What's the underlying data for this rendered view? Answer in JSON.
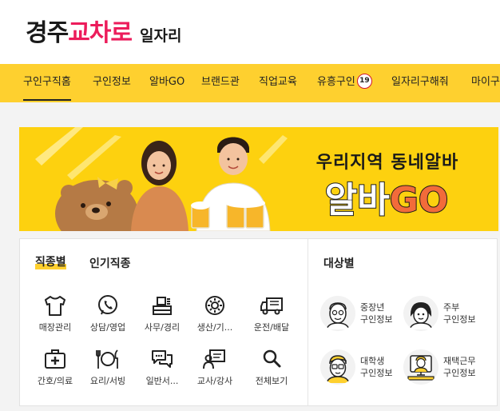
{
  "logo": {
    "part1": "경주",
    "part2": "교차로",
    "part3": "일자리"
  },
  "nav": {
    "items": [
      "구인구직홈",
      "구인정보",
      "알바GO",
      "브랜드관",
      "직업교육",
      "유흥구인",
      "일자리구해줘",
      "마이구"
    ],
    "badge": "19"
  },
  "banner": {
    "line1": "우리지역 동네알바",
    "line2a": "알바",
    "line2b": "GO"
  },
  "jobs_panel": {
    "tab_category": "직종별",
    "tab_popular": "인기직종",
    "items": [
      {
        "label": "매장관리",
        "icon": "shirt-icon"
      },
      {
        "label": "상담/영업",
        "icon": "phone-chat-icon"
      },
      {
        "label": "사무/경리",
        "icon": "office-desk-icon"
      },
      {
        "label": "생산/기...",
        "icon": "gear-icon"
      },
      {
        "label": "운전/배달",
        "icon": "truck-icon"
      },
      {
        "label": "간호/의료",
        "icon": "medical-kit-icon"
      },
      {
        "label": "요리/서빙",
        "icon": "cutlery-icon"
      },
      {
        "label": "일반서...",
        "icon": "chat-bubbles-icon"
      },
      {
        "label": "교사/강사",
        "icon": "teacher-board-icon"
      },
      {
        "label": "전체보기",
        "icon": "search-icon"
      }
    ]
  },
  "target_panel": {
    "title": "대상별",
    "items": [
      {
        "line1": "중장년",
        "line2": "구인정보",
        "icon": "middle-aged-man-avatar"
      },
      {
        "line1": "주부",
        "line2": "구인정보",
        "icon": "housewife-avatar"
      },
      {
        "line1": "대학생",
        "line2": "구인정보",
        "icon": "student-avatar"
      },
      {
        "line1": "재택근무",
        "line2": "구인정보",
        "icon": "remote-worker-avatar"
      }
    ]
  },
  "colors": {
    "brand_pink": "#ec1c5b",
    "nav_yellow": "#fed02f",
    "banner_yellow": "#fdd10f",
    "badge_red": "#d2152b",
    "go_orange": "#f26b3a"
  }
}
